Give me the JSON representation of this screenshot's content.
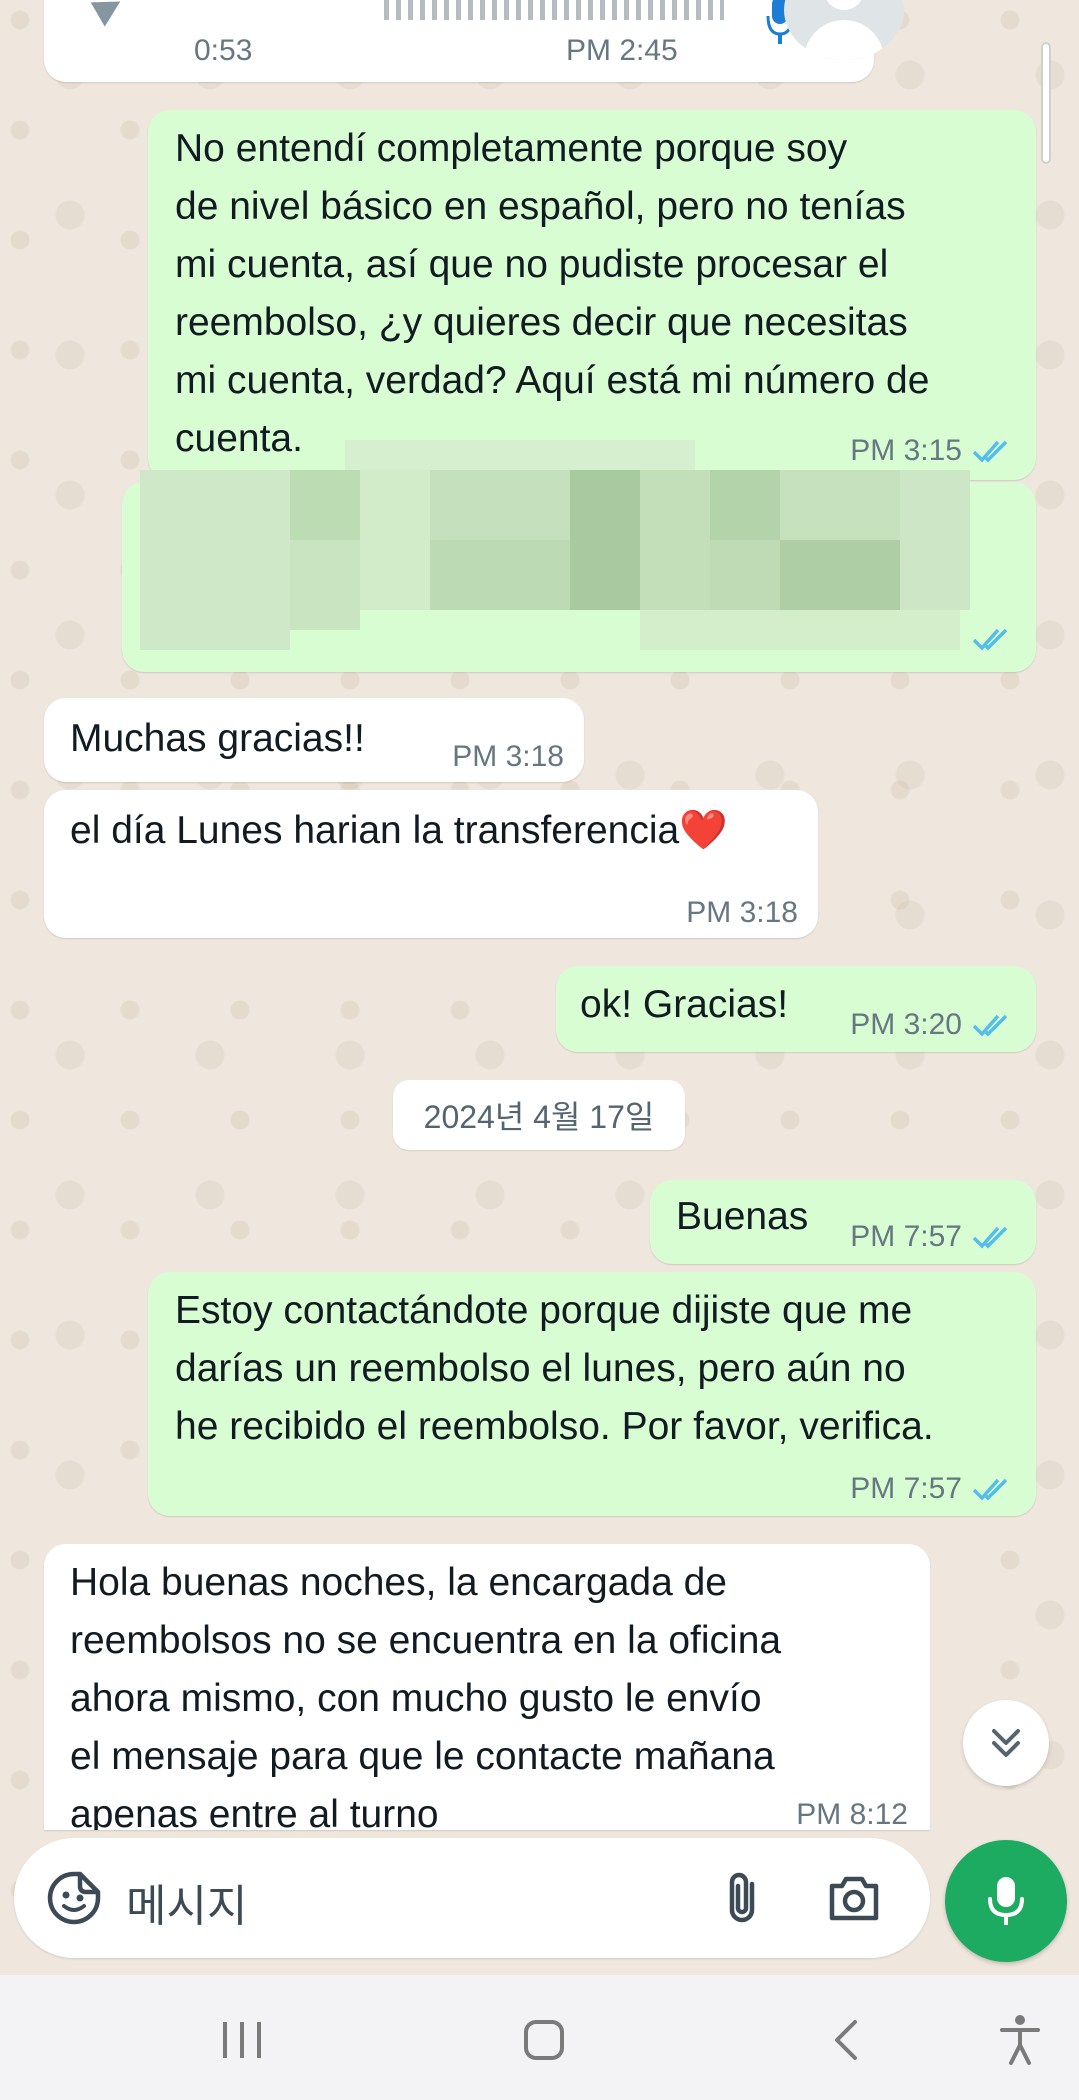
{
  "voice_message": {
    "duration": "0:53",
    "time": "PM 2:45"
  },
  "messages": [
    {
      "direction": "out",
      "text": "No entendí completamente porque soy\nde nivel básico en español, pero no tenías\nmi cuenta, así que no pudiste procesar el\nreembolso,  ¿y quieres decir que necesitas\nmi cuenta, verdad?  Aquí está mi número de\ncuenta.",
      "time": "PM 3:15",
      "status": "read"
    },
    {
      "direction": "out",
      "text": "[account number redacted]",
      "status": "read"
    },
    {
      "direction": "in",
      "text": "Muchas gracias!!",
      "time": "PM 3:18"
    },
    {
      "direction": "in",
      "text": "el día Lunes harian la transferencia❤️",
      "time": "PM 3:18"
    },
    {
      "direction": "out",
      "text": "ok! Gracias!",
      "time": "PM 3:20",
      "status": "read"
    },
    {
      "direction": "out",
      "text": "Buenas",
      "time": "PM 7:57",
      "status": "read"
    },
    {
      "direction": "out",
      "text": "Estoy contactándote porque dijiste que me\ndarías un reembolso el lunes, pero aún no\nhe recibido el reembolso. Por favor, verifica.",
      "time": "PM 7:57",
      "status": "read"
    },
    {
      "direction": "in",
      "text": "Hola buenas noches, la encargada de\nreembolsos no se encuentra en la oficina\nahora mismo, con mucho gusto le envío\nel mensaje para que le contacte mañana\napenas entre al turno",
      "time": "PM 8:12"
    }
  ],
  "date_divider": "2024년 4월 17일",
  "composer": {
    "placeholder": "메시지"
  },
  "colors": {
    "outgoing_bubble": "#d9fdd3",
    "incoming_bubble": "#ffffff",
    "read_ticks": "#53bdeb",
    "mic_button": "#1daa61",
    "wallpaper": "#efe7dd"
  },
  "icons": {
    "composer": [
      "sticker-icon",
      "attach-icon",
      "camera-icon",
      "mic-icon"
    ],
    "navbar": [
      "recent-apps-icon",
      "home-icon",
      "back-icon",
      "accessibility-icon"
    ]
  }
}
